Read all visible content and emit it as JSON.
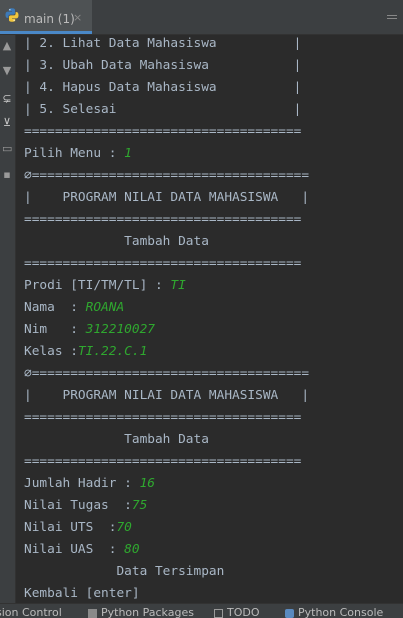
{
  "tab": {
    "label": "main (1)",
    "close": "×"
  },
  "console": {
    "menu": [
      "| 2. Lihat Data Mahasiswa          |",
      "| 3. Ubah Data Mahasiswa           |",
      "| 4. Hapus Data Mahasiswa          |",
      "| 5. Selesai                       |"
    ],
    "sep": "====================================",
    "prompt_menu": "Pilih Menu : ",
    "menu_choice": "1",
    "clear_sep": "∅====================================",
    "header_title": "|    PROGRAM NILAI DATA MAHASISWA   |",
    "tambah_data": "             Tambah Data",
    "prodi_label": "Prodi [TI/TM/TL] : ",
    "prodi_value": "TI",
    "nama_label": "Nama  : ",
    "nama_value": "ROANA",
    "nim_label": "Nim   : ",
    "nim_value": "312210027",
    "kelas_label": "Kelas :",
    "kelas_value": "TI.22.C.1",
    "hadir_label": "Jumlah Hadir : ",
    "hadir_value": "16",
    "tugas_label": "Nilai Tugas  :",
    "tugas_value": "75",
    "uts_label": "Nilai UTS  :",
    "uts_value": "70",
    "uas_label": "Nilai UAS  : ",
    "uas_value": "80",
    "tersimpan": "            Data Tersimpan",
    "kembali": "Kembali [enter]"
  },
  "bottom_tabs": [
    "sion Control",
    "Python Packages",
    "TODO",
    "Python Console"
  ],
  "colors": {
    "background": "#2b2b2b",
    "text": "#a9b7c6",
    "input": "#2fa82f",
    "chrome": "#3c3f41"
  },
  "icons": [
    "python-file-icon",
    "close-icon",
    "more-icon",
    "up-arrow-icon",
    "down-arrow-icon",
    "wrap-icon",
    "scroll-end-icon",
    "print-icon",
    "trash-icon"
  ]
}
